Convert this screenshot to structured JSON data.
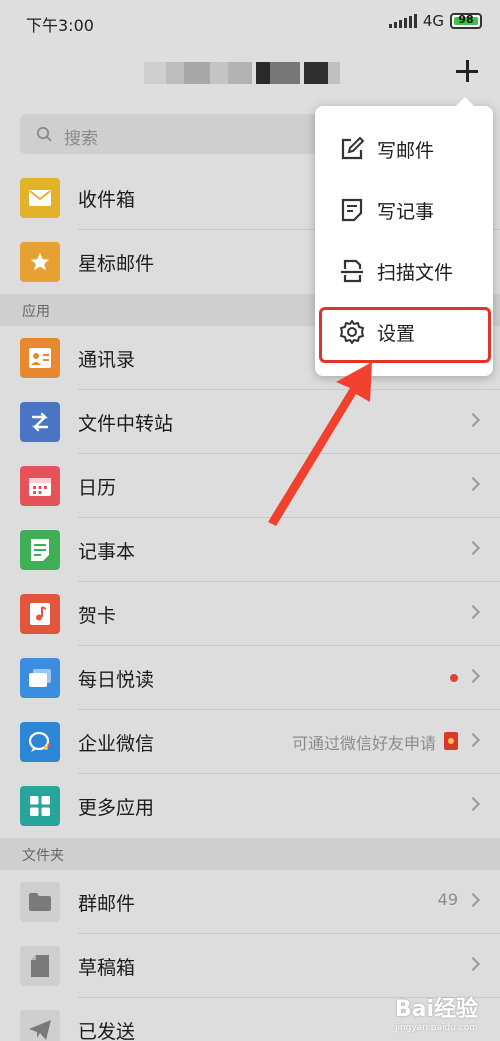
{
  "status_bar": {
    "time": "下午3:00",
    "network": "4G",
    "battery": "98"
  },
  "search": {
    "placeholder": "搜索"
  },
  "items": {
    "inbox": "收件箱",
    "starred": "星标邮件",
    "contacts": "通讯录",
    "transfer": "文件中转站",
    "calendar": "日历",
    "notes": "记事本",
    "greeting": "贺卡",
    "daily_read": "每日悦读",
    "wework": "企业微信",
    "wework_hint": "可通过微信好友申请",
    "more_apps": "更多应用",
    "group_mail": "群邮件",
    "group_mail_count": "49",
    "drafts": "草稿箱",
    "sent": "已发送"
  },
  "sections": {
    "apps": "应用",
    "folders": "文件夹"
  },
  "popup_menu": {
    "compose": "写邮件",
    "write_note": "写记事",
    "scan": "扫描文件",
    "settings": "设置"
  },
  "watermark": {
    "brand": "Bai经验",
    "url": "jingyan.baidu.com"
  },
  "colors": {
    "inbox": "#e2b22a",
    "starred": "#e6a132",
    "contacts": "#e8892f",
    "transfer": "#4a75c4",
    "calendar": "#e4525a",
    "notes": "#3fae54",
    "greeting": "#e2553e",
    "daily_read": "#3b8de0",
    "wework": "#2c86d6",
    "more_apps": "#27a59a",
    "highlight": "#e5312c"
  }
}
